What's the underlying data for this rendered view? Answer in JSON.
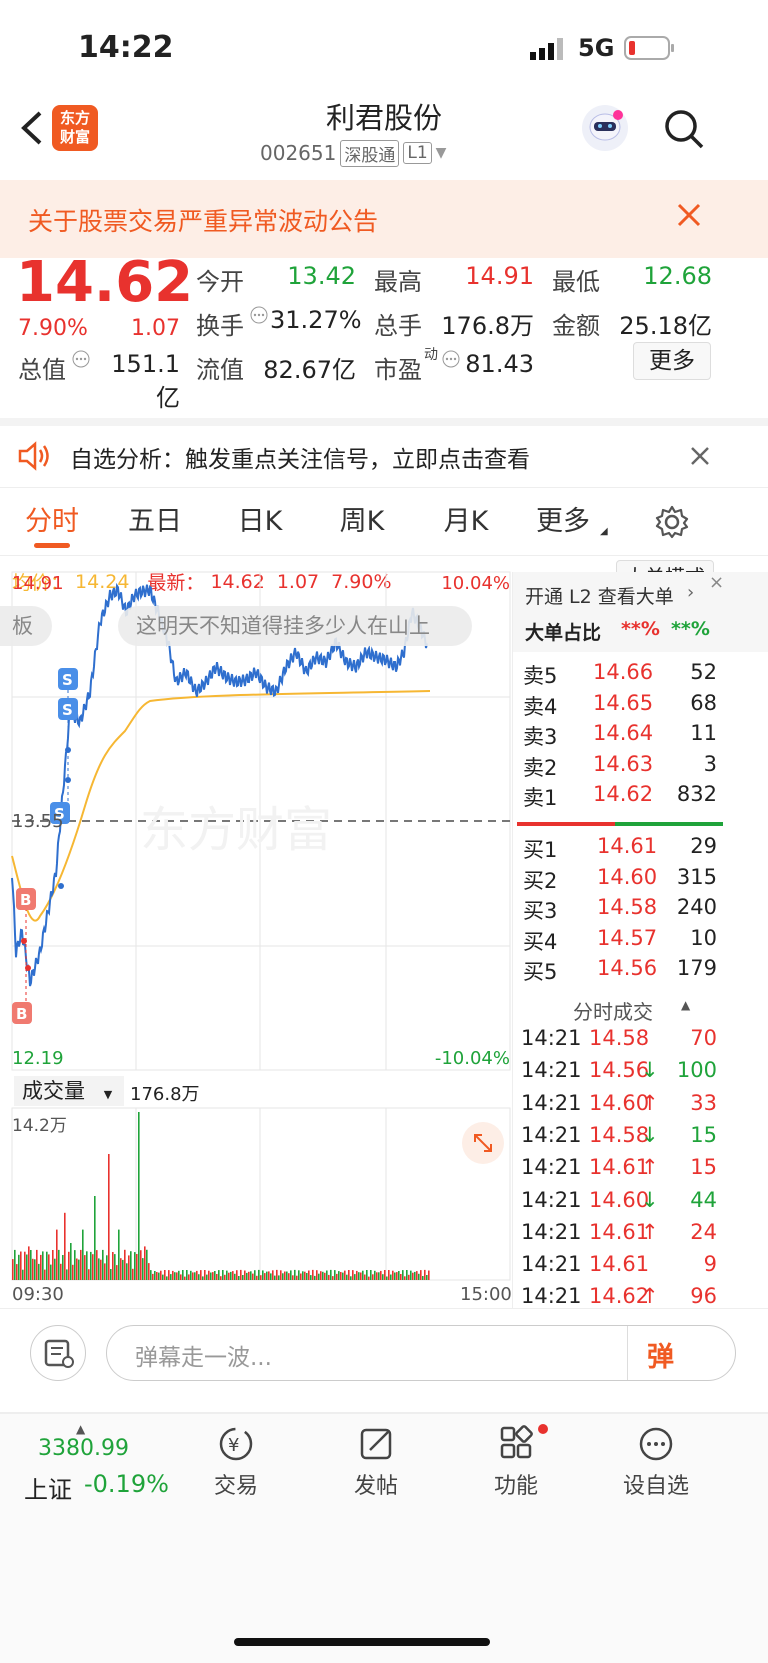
{
  "status": {
    "time": "14:22",
    "network": "5G"
  },
  "nav": {
    "title": "利君股份",
    "code": "002651",
    "market": "深股通",
    "level": "L1",
    "logo_line1": "东方",
    "logo_line2": "财富"
  },
  "notice": {
    "text": "关于股票交易严重异常波动公告"
  },
  "quote": {
    "price": "14.62",
    "change_pct": "7.90%",
    "change": "1.07",
    "open_label": "今开",
    "open": "13.42",
    "high_label": "最高",
    "high": "14.91",
    "low_label": "最低",
    "low": "12.68",
    "turnover_label": "换手",
    "turnover": "31.27%",
    "volume_label": "总手",
    "volume": "176.8万",
    "amount_label": "金额",
    "amount": "25.18亿",
    "mktcap_label": "总值",
    "mktcap": "151.1亿",
    "float_label": "流值",
    "float": "82.67亿",
    "pe_label": "市盈",
    "pe_sup": "动",
    "pe": "81.43",
    "more_button": "更多"
  },
  "alert": {
    "text": "自选分析：触发重点关注信号，立即点击查看"
  },
  "tabs": {
    "items": [
      "分时",
      "五日",
      "日K",
      "周K",
      "月K",
      "更多"
    ],
    "active": 0
  },
  "chart": {
    "avg_label": "均价：",
    "avg": "14.24",
    "last_label": "最新：",
    "last": "14.62",
    "chg": "1.07",
    "pct": "7.90%",
    "mode_button": "大单模式",
    "y_max": "14.91",
    "y_mid": "13.55",
    "y_min": "12.19",
    "pct_max": "10.04%",
    "pct_min": "-10.04%",
    "danmu_left": "板",
    "danmu_text": "这明天不知道得挂多少人在山上",
    "watermark": "东方财富",
    "vol_label": "成交量",
    "vol_total": "176.8万",
    "vol_max": "14.2万",
    "time_start": "09:30",
    "time_end": "15:00",
    "marker_b": "B",
    "marker_s": "S"
  },
  "orderbook": {
    "l2_link": "开通 L2 查看大单",
    "big_label": "大单占比",
    "big_a": "**%",
    "big_b": "**%",
    "asks": [
      {
        "label": "卖5",
        "price": "14.66",
        "vol": "52"
      },
      {
        "label": "卖4",
        "price": "14.65",
        "vol": "68"
      },
      {
        "label": "卖3",
        "price": "14.64",
        "vol": "11"
      },
      {
        "label": "卖2",
        "price": "14.63",
        "vol": "3"
      },
      {
        "label": "卖1",
        "price": "14.62",
        "vol": "832"
      }
    ],
    "bids": [
      {
        "label": "买1",
        "price": "14.61",
        "vol": "29"
      },
      {
        "label": "买2",
        "price": "14.60",
        "vol": "315"
      },
      {
        "label": "买3",
        "price": "14.58",
        "vol": "240"
      },
      {
        "label": "买4",
        "price": "14.57",
        "vol": "10"
      },
      {
        "label": "买5",
        "price": "14.56",
        "vol": "179"
      }
    ],
    "ticks_title": "分时成交",
    "ticks": [
      {
        "time": "14:21",
        "price": "14.58",
        "arrow": "",
        "vol": "70",
        "dir": "up"
      },
      {
        "time": "14:21",
        "price": "14.56",
        "arrow": "↓",
        "vol": "100",
        "dir": "down"
      },
      {
        "time": "14:21",
        "price": "14.60",
        "arrow": "↑",
        "vol": "33",
        "dir": "up"
      },
      {
        "time": "14:21",
        "price": "14.58",
        "arrow": "↓",
        "vol": "15",
        "dir": "down"
      },
      {
        "time": "14:21",
        "price": "14.61",
        "arrow": "↑",
        "vol": "15",
        "dir": "up"
      },
      {
        "time": "14:21",
        "price": "14.60",
        "arrow": "↓",
        "vol": "44",
        "dir": "down"
      },
      {
        "time": "14:21",
        "price": "14.61",
        "arrow": "↑",
        "vol": "24",
        "dir": "up"
      },
      {
        "time": "14:21",
        "price": "14.61",
        "arrow": "",
        "vol": "9",
        "dir": "up"
      },
      {
        "time": "14:21",
        "price": "14.62",
        "arrow": "↑",
        "vol": "96",
        "dir": "up"
      }
    ]
  },
  "comment": {
    "placeholder": "弹幕走一波...",
    "danmu_btn": "弹"
  },
  "bottom": {
    "index_value": "3380.99",
    "index_name": "上证",
    "index_pct": "-0.19%",
    "items": [
      "交易",
      "发帖",
      "功能",
      "设自选"
    ]
  },
  "colors": {
    "up": "#e8322e",
    "down": "#1fa33a",
    "accent": "#f05a22",
    "price_line": "#2f6fce",
    "avg_line": "#f6b733"
  }
}
